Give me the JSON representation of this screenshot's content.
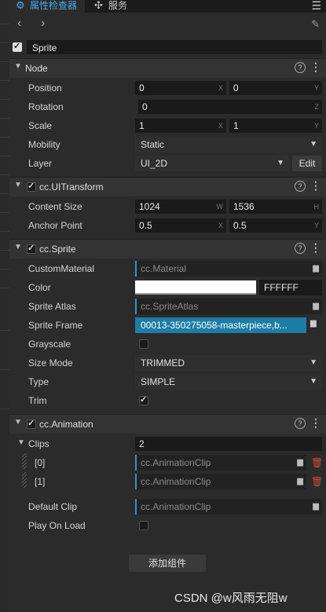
{
  "tabs": [
    {
      "label": "属性检查器",
      "icon": "inspector-icon"
    },
    {
      "label": "服务",
      "icon": "services-icon"
    }
  ],
  "node_name": "Sprite",
  "sections": {
    "node": "Node",
    "ui_transform": "cc.UITransform",
    "sprite": "cc.Sprite",
    "animation": "cc.Animation"
  },
  "help_glyph": "?",
  "node": {
    "position": {
      "label": "Position",
      "x": "0",
      "y": "0"
    },
    "rotation": {
      "label": "Rotation",
      "z": "0"
    },
    "scale": {
      "label": "Scale",
      "x": "1",
      "y": "1"
    },
    "mobility": {
      "label": "Mobility",
      "value": "Static"
    },
    "layer": {
      "label": "Layer",
      "value": "UI_2D",
      "edit_label": "Edit"
    }
  },
  "axis": {
    "x": "X",
    "y": "Y",
    "z": "Z",
    "w": "W",
    "h": "H"
  },
  "ui_transform": {
    "content_size": {
      "label": "Content Size",
      "w": "1024",
      "h": "1536"
    },
    "anchor_point": {
      "label": "Anchor Point",
      "x": "0.5",
      "y": "0.5"
    }
  },
  "sprite": {
    "custom_material": {
      "label": "CustomMaterial",
      "value": "cc.Material"
    },
    "color": {
      "label": "Color",
      "hex": "FFFFFF",
      "swatch": "#ffffff"
    },
    "sprite_atlas": {
      "label": "Sprite Atlas",
      "value": "cc.SpriteAtlas"
    },
    "sprite_frame": {
      "label": "Sprite Frame",
      "value": "00013-350275058-masterpiece,b..."
    },
    "grayscale": {
      "label": "Grayscale",
      "checked": false
    },
    "size_mode": {
      "label": "Size Mode",
      "value": "TRIMMED"
    },
    "type": {
      "label": "Type",
      "value": "SIMPLE"
    },
    "trim": {
      "label": "Trim",
      "checked": true
    }
  },
  "animation": {
    "clips": {
      "label": "Clips",
      "count": "2"
    },
    "clip_items": [
      {
        "index": "[0]",
        "value": "cc.AnimationClip"
      },
      {
        "index": "[1]",
        "value": "cc.AnimationClip"
      }
    ],
    "default_clip": {
      "label": "Default Clip",
      "value": "cc.AnimationClip"
    },
    "play_on_load": {
      "label": "Play On Load",
      "checked": false
    }
  },
  "add_component_label": "添加组件",
  "watermark": "CSDN @w风雨无阻w",
  "colors": {
    "accent": "#4aa8e8",
    "asset_selected": "#1e7da6",
    "delete": "#d04a3a"
  }
}
